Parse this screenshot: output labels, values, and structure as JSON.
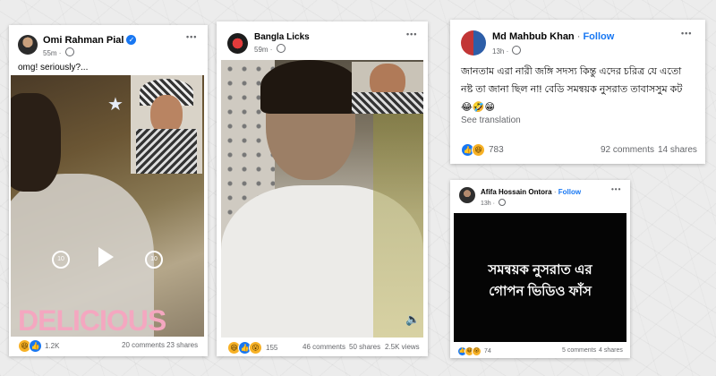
{
  "posts": [
    {
      "author": "Omi Rahman Pial",
      "time": "55m",
      "verified": true,
      "text": "omg! seriously?...",
      "video_overlay_text": "DELICIOUS",
      "reaction_count": "1.2K",
      "comments": "20 comments",
      "shares": "23 shares",
      "rewind_label": "10",
      "forward_label": "10"
    },
    {
      "author": "Bangla Licks",
      "time": "59m",
      "reaction_count": "155",
      "comments": "46 comments",
      "shares": "50 shares",
      "views": "2.5K views"
    },
    {
      "author": "Md Mahbub Khan",
      "follow": "Follow",
      "separator": "·",
      "time": "13h",
      "text": "জানতাম এরা নারী জঙ্গি সদস্য কিন্তু এদের চরিত্র যে এতো নষ্ট তা জানা ছিল না! বেডি সমন্বয়ক নুসরাত তাবাসসুম কট😂🤣😁",
      "see_translation": "See translation",
      "reaction_count": "783",
      "comments": "92 comments",
      "shares": "14 shares"
    },
    {
      "author": "Afifa Hossain Ontora",
      "follow": "Follow",
      "separator": "·",
      "time": "13h",
      "image_text_line1": "সমন্বয়ক নুসরাত এর",
      "image_text_line2": "গোপন ভিডিও ফাঁস",
      "reaction_count": "74",
      "comments": "5 comments",
      "shares": "4 shares"
    }
  ],
  "more_icon": "•••",
  "colors": {
    "facebook_blue": "#1877f2",
    "meta_gray": "#65676b"
  }
}
